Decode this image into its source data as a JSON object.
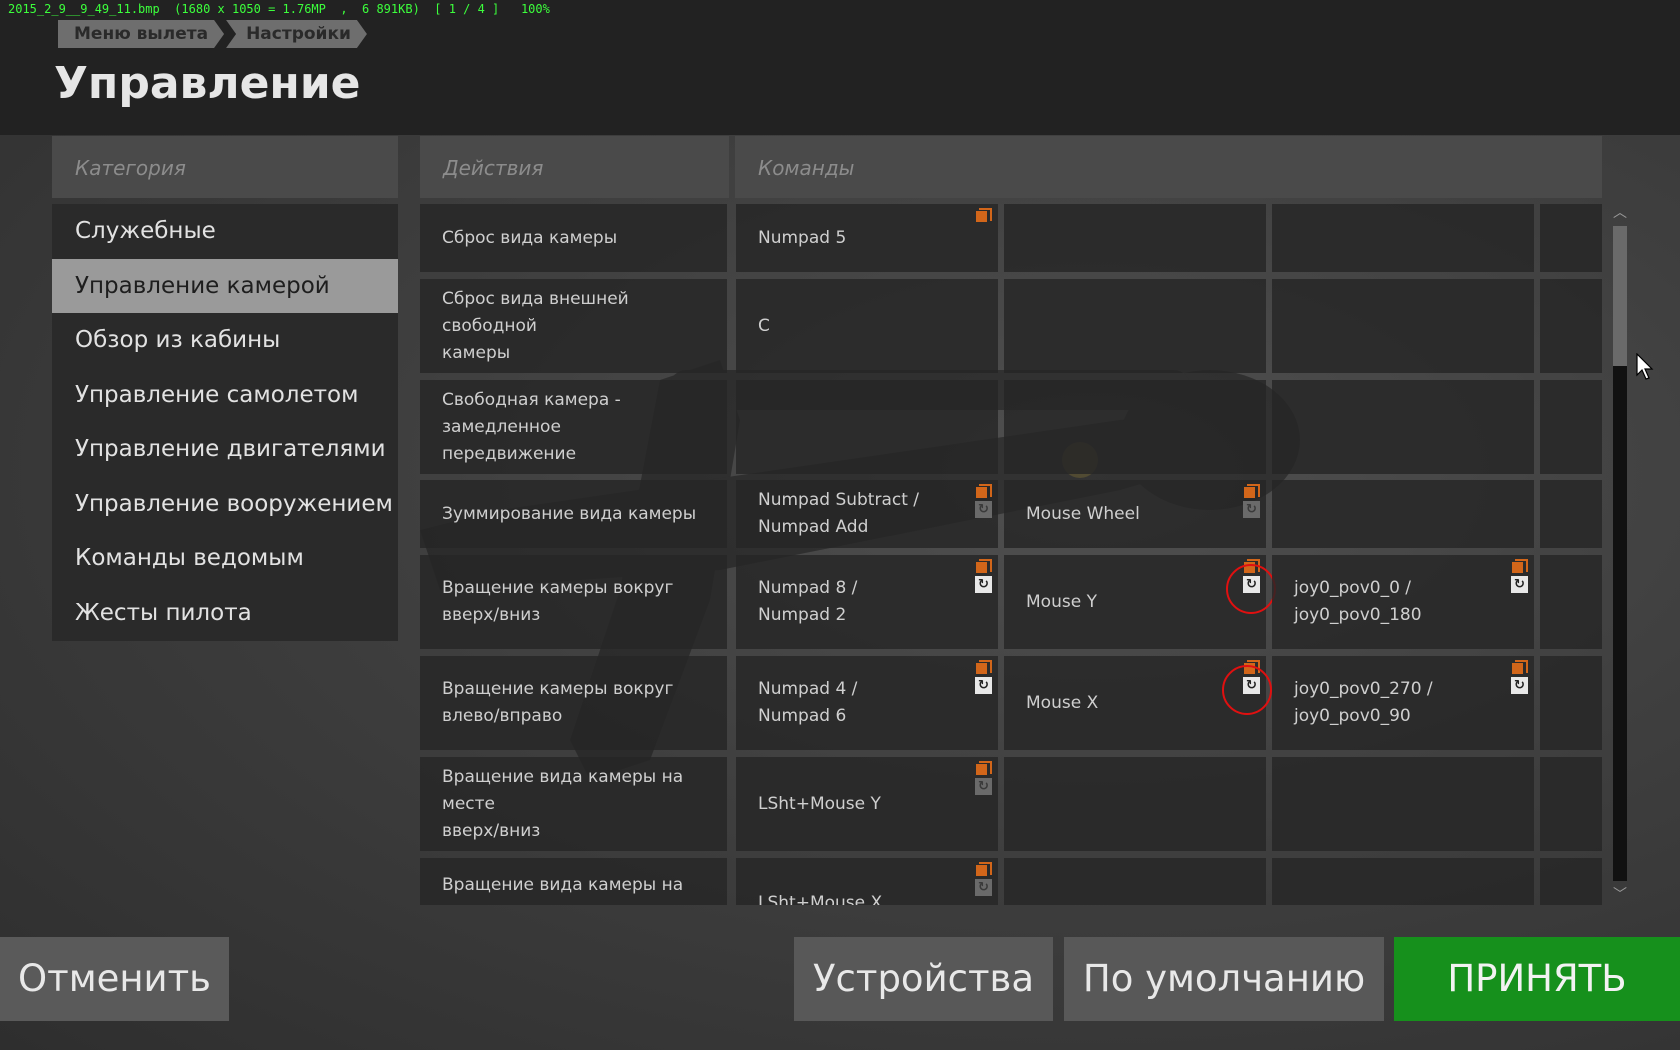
{
  "viewer": {
    "info": "2015_2_9__9_49_11.bmp  (1680 x 1050 = 1.76MP  ,  6 891KB)  [ 1 / 4 ]   100%"
  },
  "breadcrumb": [
    "Меню вылета",
    "Настройки"
  ],
  "title": "Управление",
  "categories": {
    "header": "Категория",
    "items": [
      "Служебные",
      "Управление камерой",
      "Обзор из кабины",
      "Управление самолетом",
      "Управление двигателями",
      "Управление вооружением",
      "Команды ведомым",
      "Жесты пилота"
    ],
    "selected_index": 1
  },
  "table": {
    "col_actions": "Действия",
    "col_commands": "Команды",
    "rows": [
      {
        "action": "Сброс вида камеры",
        "k1": "Numpad 5",
        "k2": "",
        "k3": ""
      },
      {
        "action": "Сброс вида внешней свободной\nкамеры",
        "k1": "C",
        "k2": "",
        "k3": ""
      },
      {
        "action": "Свободная камера - замедленное\nпередвижение",
        "k1": "",
        "k2": "",
        "k3": ""
      },
      {
        "action": "Зуммирование вида камеры",
        "k1": "Numpad Subtract /\nNumpad Add",
        "k2": "Mouse Wheel",
        "k3": ""
      },
      {
        "action": "Вращение камеры вокруг\nвверх/вниз",
        "k1": "Numpad 8 /\nNumpad 2",
        "k2": "Mouse Y",
        "k3": "joy0_pov0_0 /\njoy0_pov0_180"
      },
      {
        "action": "Вращение камеры вокруг\nвлево/вправо",
        "k1": "Numpad 4 /\nNumpad 6",
        "k2": "Mouse X",
        "k3": "joy0_pov0_270 /\njoy0_pov0_90"
      },
      {
        "action": "Вращение вида камеры на месте\nвверх/вниз",
        "k1": "LSht+Mouse Y",
        "k2": "",
        "k3": ""
      },
      {
        "action": "Вращение вида камеры на месте",
        "k1": "LSht+Mouse X",
        "k2": "",
        "k3": ""
      }
    ]
  },
  "icons": {
    "invert": "↻"
  },
  "buttons": {
    "cancel": "Отменить",
    "devices": "Устройства",
    "defaults": "По умолчанию",
    "accept": "ПРИНЯТЬ"
  },
  "colors": {
    "accent_green": "#16901c",
    "binding_orange": "#d2661a",
    "annotation_red": "#e01010"
  }
}
